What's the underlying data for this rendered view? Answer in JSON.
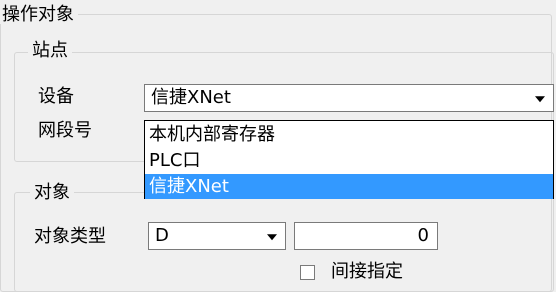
{
  "sections": {
    "operation_target": {
      "title": "操作对象"
    },
    "station": {
      "title": "站点",
      "device_label": "设备",
      "device_value": "信捷XNet",
      "segment_label": "网段号",
      "device_options": [
        "本机内部寄存器",
        "PLC口",
        "信捷XNet"
      ],
      "selected_option": "信捷XNet"
    },
    "object": {
      "title": "对象",
      "type_label": "对象类型",
      "type_value": "D",
      "address_value": "0",
      "indirect_label": "间接指定",
      "indirect_checked": false
    }
  },
  "icons": {
    "combo_arrow": "chevron-down-icon"
  },
  "colors": {
    "background": "#f0f0f0",
    "selection": "#3399ff",
    "border": "#7a7a7a"
  }
}
